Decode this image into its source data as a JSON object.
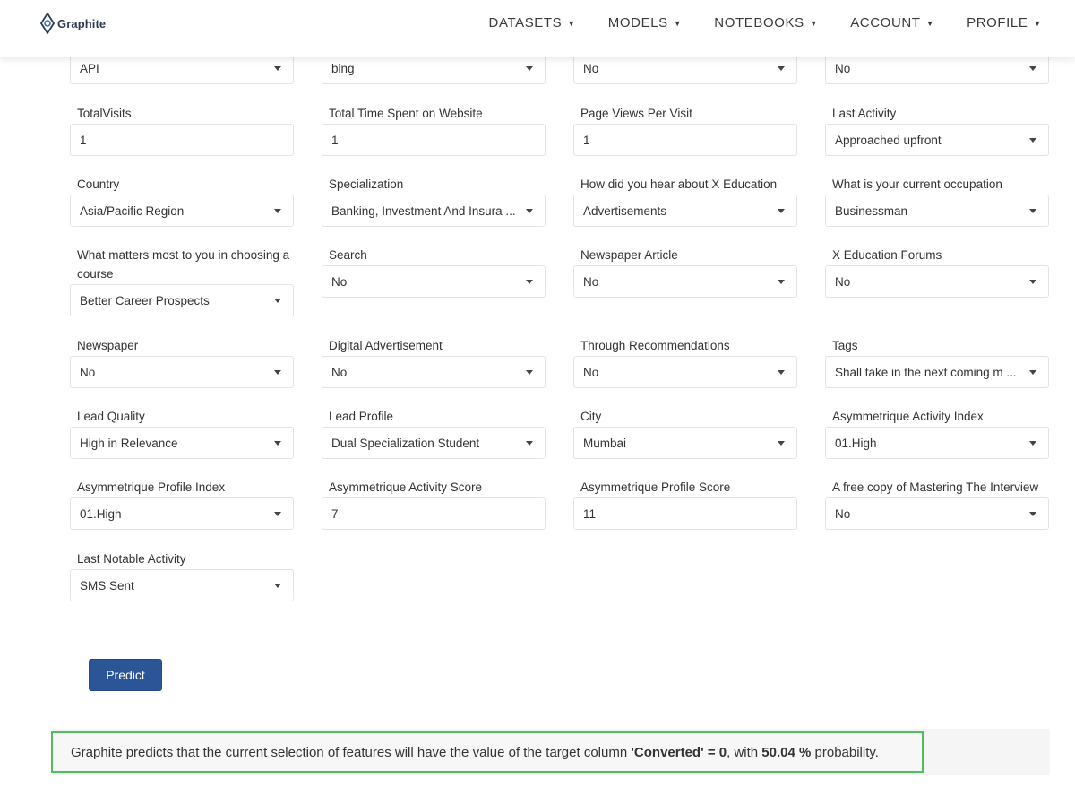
{
  "brand": {
    "name": "Graphite"
  },
  "nav": [
    {
      "label": "DATASETS"
    },
    {
      "label": "MODELS"
    },
    {
      "label": "NOTEBOOKS"
    },
    {
      "label": "ACCOUNT"
    },
    {
      "label": "PROFILE"
    }
  ],
  "fields": {
    "lead_source": {
      "value": "API"
    },
    "lead_origin": {
      "value": "bing"
    },
    "do_not_email": {
      "value": "No"
    },
    "do_not_call": {
      "value": "No"
    },
    "total_visits": {
      "label": "TotalVisits",
      "value": "1"
    },
    "time_on_site": {
      "label": "Total Time Spent on Website",
      "value": "1"
    },
    "page_views": {
      "label": "Page Views Per Visit",
      "value": "1"
    },
    "last_activity": {
      "label": "Last Activity",
      "value": "Approached upfront"
    },
    "country": {
      "label": "Country",
      "value": "Asia/Pacific Region"
    },
    "specialization": {
      "label": "Specialization",
      "value": "Banking, Investment And Insura ..."
    },
    "hear_about": {
      "label": "How did you hear about X Education",
      "value": "Advertisements"
    },
    "occupation": {
      "label": "What is your current occupation",
      "value": "Businessman"
    },
    "matters_most": {
      "label": "What matters most to you in choosing a course",
      "value": "Better Career Prospects"
    },
    "search": {
      "label": "Search",
      "value": "No"
    },
    "newspaper_article": {
      "label": "Newspaper Article",
      "value": "No"
    },
    "forums": {
      "label": "X Education Forums",
      "value": "No"
    },
    "newspaper": {
      "label": "Newspaper",
      "value": "No"
    },
    "digital_ad": {
      "label": "Digital Advertisement",
      "value": "No"
    },
    "recommendations": {
      "label": "Through Recommendations",
      "value": "No"
    },
    "tags": {
      "label": "Tags",
      "value": "Shall take in the next coming m  ..."
    },
    "lead_quality": {
      "label": "Lead Quality",
      "value": "High in Relevance"
    },
    "lead_profile": {
      "label": "Lead Profile",
      "value": "Dual Specialization Student"
    },
    "city": {
      "label": "City",
      "value": "Mumbai"
    },
    "activity_index": {
      "label": "Asymmetrique Activity Index",
      "value": "01.High"
    },
    "profile_index": {
      "label": "Asymmetrique Profile Index",
      "value": "01.High"
    },
    "activity_score": {
      "label": "Asymmetrique Activity Score",
      "value": "7"
    },
    "profile_score": {
      "label": "Asymmetrique Profile Score",
      "value": "11"
    },
    "free_copy": {
      "label": "A free copy of Mastering The Interview",
      "value": "No"
    },
    "last_notable": {
      "label": "Last Notable Activity",
      "value": "SMS Sent"
    }
  },
  "predict_button": {
    "label": "Predict"
  },
  "result": {
    "prefix": "Graphite predicts that the current selection of features will have the value of the target column ",
    "target_column": "'Converted' = 0",
    "middle": ", with ",
    "probability": "50.04 %",
    "suffix": " probability."
  },
  "colors": {
    "primary_button": "#2c5597",
    "result_border": "#4cc05c",
    "brand_text": "#2b3a55"
  }
}
